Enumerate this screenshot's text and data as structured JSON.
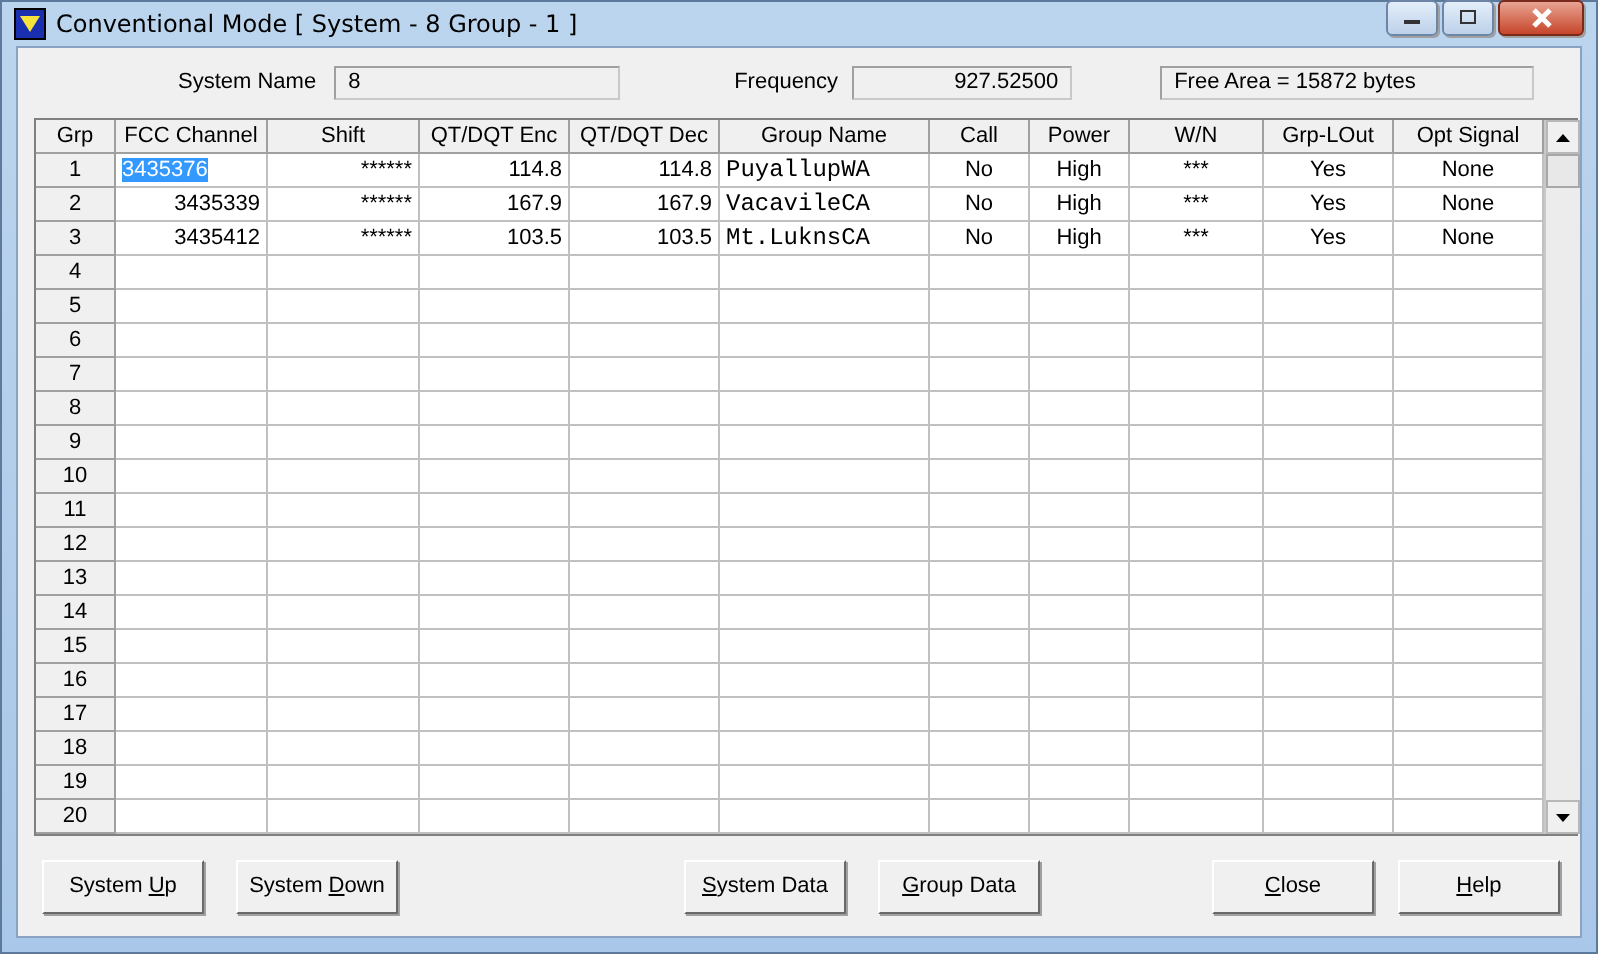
{
  "window": {
    "title": "Conventional Mode [ System - 8  Group - 1 ]"
  },
  "info": {
    "system_name_label": "System Name",
    "system_name": "8",
    "frequency_label": "Frequency",
    "frequency": "927.52500",
    "free_area": "Free Area = 15872 bytes"
  },
  "table": {
    "columns": [
      "Grp",
      "FCC Channel",
      "Shift",
      "QT/DQT Enc",
      "QT/DQT Dec",
      "Group Name",
      "Call",
      "Power",
      "W/N",
      "Grp-LOut",
      "Opt Signal"
    ],
    "rows": [
      {
        "grp": "1",
        "selected": true,
        "cells": [
          "3435376",
          "******",
          "114.8",
          "114.8",
          "PuyallupWA",
          "No",
          "High",
          "***",
          "Yes",
          "None"
        ]
      },
      {
        "grp": "2",
        "selected": false,
        "cells": [
          "3435339",
          "******",
          "167.9",
          "167.9",
          "VacavileCA",
          "No",
          "High",
          "***",
          "Yes",
          "None"
        ]
      },
      {
        "grp": "3",
        "selected": false,
        "cells": [
          "3435412",
          "******",
          "103.5",
          "103.5",
          "Mt.LuknsCA",
          "No",
          "High",
          "***",
          "Yes",
          "None"
        ]
      },
      {
        "grp": "4",
        "selected": false
      },
      {
        "grp": "5",
        "selected": false
      },
      {
        "grp": "6",
        "selected": false
      },
      {
        "grp": "7",
        "selected": false
      },
      {
        "grp": "8",
        "selected": false
      },
      {
        "grp": "9",
        "selected": false
      },
      {
        "grp": "10",
        "selected": false
      },
      {
        "grp": "11",
        "selected": false
      },
      {
        "grp": "12",
        "selected": false
      },
      {
        "grp": "13",
        "selected": false
      },
      {
        "grp": "14",
        "selected": false
      },
      {
        "grp": "15",
        "selected": false
      },
      {
        "grp": "16",
        "selected": false
      },
      {
        "grp": "17",
        "selected": false
      },
      {
        "grp": "18",
        "selected": false
      },
      {
        "grp": "19",
        "selected": false
      },
      {
        "grp": "20",
        "selected": false
      }
    ]
  },
  "buttons": [
    {
      "before": "System ",
      "key": "U",
      "after": "p"
    },
    {
      "before": "System ",
      "key": "D",
      "after": "own"
    },
    {
      "key": "S",
      "after": "ystem Data"
    },
    {
      "key": "G",
      "after": "roup Data"
    },
    {
      "key": "C",
      "after": "lose"
    },
    {
      "key": "H",
      "after": "elp"
    }
  ]
}
